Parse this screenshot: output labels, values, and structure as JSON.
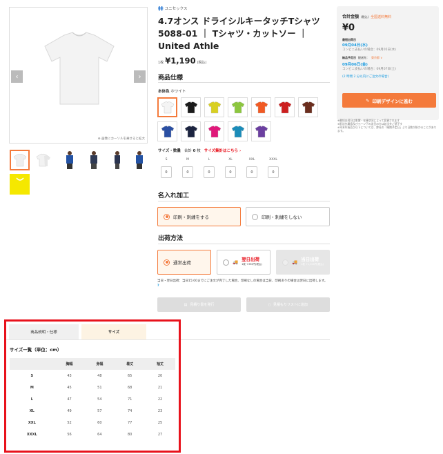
{
  "gallery": {
    "zoom_hint": "画像にカーソルを乗せると拡大",
    "prev": "‹",
    "next": "›"
  },
  "product": {
    "brand": "ユニセックス",
    "title": "4.7オンス ドライシルキータッチTシャツ 5088-01 ｜ Tシャツ・カットソー ｜ United Athle",
    "price_prefix": "1枚",
    "price": "¥1,190",
    "price_note": "(税込)"
  },
  "spec": {
    "heading": "商品仕様",
    "color_label": "本体色",
    "color_value": "ホワイト",
    "colors": [
      "#f4f4f4",
      "#1b1b1b",
      "#d9d022",
      "#8cc63f",
      "#f15a24",
      "#cc1f1f",
      "#6b2e1e",
      "#2a4fa3",
      "#1c2440",
      "#e0187a",
      "#1b8cb9",
      "#6b3fa0"
    ]
  },
  "sizes": {
    "label": "サイズ・数量",
    "total_label": "合計",
    "total_value": "0",
    "total_unit": "枚",
    "link": "サイズ集計はこちら ›",
    "items": [
      "S",
      "M",
      "L",
      "XL",
      "XXL",
      "XXXL"
    ],
    "qty": [
      "0",
      "0",
      "0",
      "0",
      "0",
      "0"
    ]
  },
  "print": {
    "heading": "名入れ加工",
    "opt1": "印刷・刺繍をする",
    "opt2": "印刷・刺繍をしない"
  },
  "shipping": {
    "heading": "出荷方法",
    "opt1": "通常出荷",
    "opt2": "翌日出荷",
    "opt2_sub": "1枚 +330円(税込)",
    "opt3": "当日出荷",
    "opt3_sub": "1枚 +1,100円(税込)",
    "note": "当日・翌日出荷：当日15:00までにご注文が完了した場合、印刷なしの場合は当日、印刷ありの場合は翌日に出荷します。",
    "help": "?"
  },
  "actions": {
    "quote": "見積り書を発行",
    "save": "見積もりリストに追加"
  },
  "sidebar": {
    "total_label": "合計金額",
    "tax_note": "(税込)",
    "free_ship": "全国送料無料",
    "total": "¥0",
    "ship_label": "最短出荷日",
    "ship_date": "09月04日(水)",
    "ship_conv": "コンビニ支払いの場合：09月05日(木)",
    "arrive_label": "納品予定日",
    "arrive_to": "配送先：",
    "arrive_pref": "東京都 ∨",
    "arrive_date": "09月06日(金)",
    "arrive_conv": "コンビニ支払いの場合：09月07日(土)",
    "countdown": "(2 時間 2 分以内にご注文の場合)",
    "design_btn": "印刷デザインに進む",
    "notes": [
      "※最短出荷日は影響・在庫状況によって変更されます",
      "※配送先離島及びページ下の送日の方は該当外ご値下す",
      "※年末年始及び以下については、弊社の「納期予定日」より日数が掛かることがあります。"
    ]
  },
  "size_table": {
    "tab1": "商品説明・仕様",
    "tab2": "サイズ",
    "caption": "サイズ一覧（単位：cm）",
    "headers": [
      "",
      "胸幅",
      "身幅",
      "着丈",
      "袖丈"
    ],
    "rows": [
      [
        "S",
        "43",
        "48",
        "65",
        "20"
      ],
      [
        "M",
        "45",
        "51",
        "68",
        "21"
      ],
      [
        "L",
        "47",
        "54",
        "71",
        "22"
      ],
      [
        "XL",
        "49",
        "57",
        "74",
        "23"
      ],
      [
        "XXL",
        "52",
        "60",
        "77",
        "25"
      ],
      [
        "XXXL",
        "56",
        "64",
        "80",
        "27"
      ]
    ]
  }
}
